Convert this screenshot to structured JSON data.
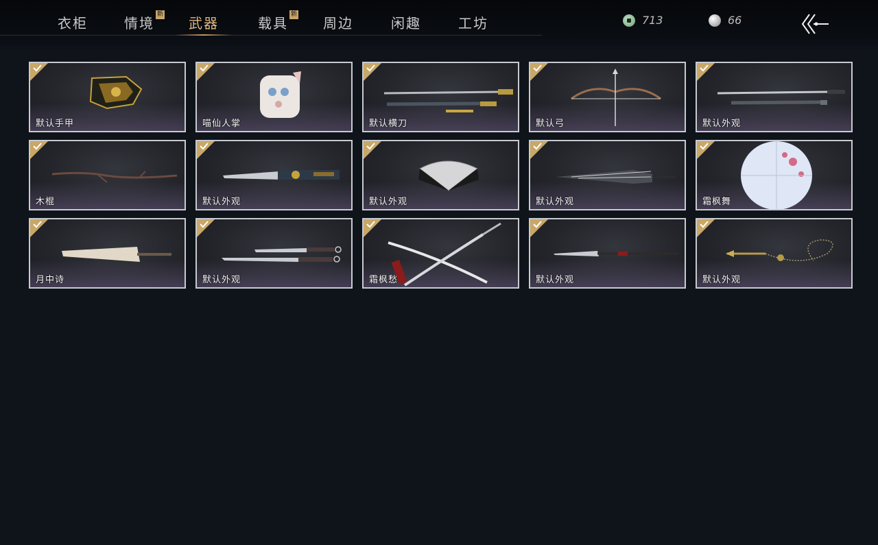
{
  "tabs": [
    {
      "label": "衣柜",
      "new": false,
      "active": false
    },
    {
      "label": "情境",
      "new": true,
      "active": false
    },
    {
      "label": "武器",
      "new": false,
      "active": true
    },
    {
      "label": "载具",
      "new": true,
      "active": false
    },
    {
      "label": "周边",
      "new": false,
      "active": false
    },
    {
      "label": "闲趣",
      "new": false,
      "active": false
    },
    {
      "label": "工坊",
      "new": false,
      "active": false
    }
  ],
  "new_badge": "新",
  "currency": {
    "coin_icon": "jade-coin-icon",
    "coins": "713",
    "pearl_icon": "pearl-icon",
    "pearls": "66"
  },
  "back_icon": "back-arrow-icon",
  "colors": {
    "accent": "#e0b780",
    "check": "#c8a767",
    "card_border": "#c8cbd0",
    "background": "#0f131a"
  },
  "items": [
    {
      "label": "默认手甲",
      "icon": "gauntlet-icon",
      "owned": true
    },
    {
      "label": "喵仙人掌",
      "icon": "cat-paw-icon",
      "owned": true
    },
    {
      "label": "默认横刀",
      "icon": "sword-scabbard-icon",
      "owned": true
    },
    {
      "label": "默认弓",
      "icon": "bow-icon",
      "owned": true
    },
    {
      "label": "默认外观",
      "icon": "twin-sword-icon",
      "owned": true
    },
    {
      "label": "木棍",
      "icon": "wooden-stick-icon",
      "owned": true
    },
    {
      "label": "默认外观",
      "icon": "ornate-blade-icon",
      "owned": true
    },
    {
      "label": "默认外观",
      "icon": "folding-fan-icon",
      "owned": true
    },
    {
      "label": "默认外观",
      "icon": "closed-umbrella-icon",
      "owned": true
    },
    {
      "label": "霜枫舞",
      "icon": "open-umbrella-icon",
      "owned": true
    },
    {
      "label": "月中诗",
      "icon": "paper-umbrella-icon",
      "owned": true
    },
    {
      "label": "默认外观",
      "icon": "dual-sabers-icon",
      "owned": true
    },
    {
      "label": "霜枫愁",
      "icon": "crossed-swords-icon",
      "owned": true
    },
    {
      "label": "默认外观",
      "icon": "spear-icon",
      "owned": true
    },
    {
      "label": "默认外观",
      "icon": "chain-dart-icon",
      "owned": true
    }
  ]
}
